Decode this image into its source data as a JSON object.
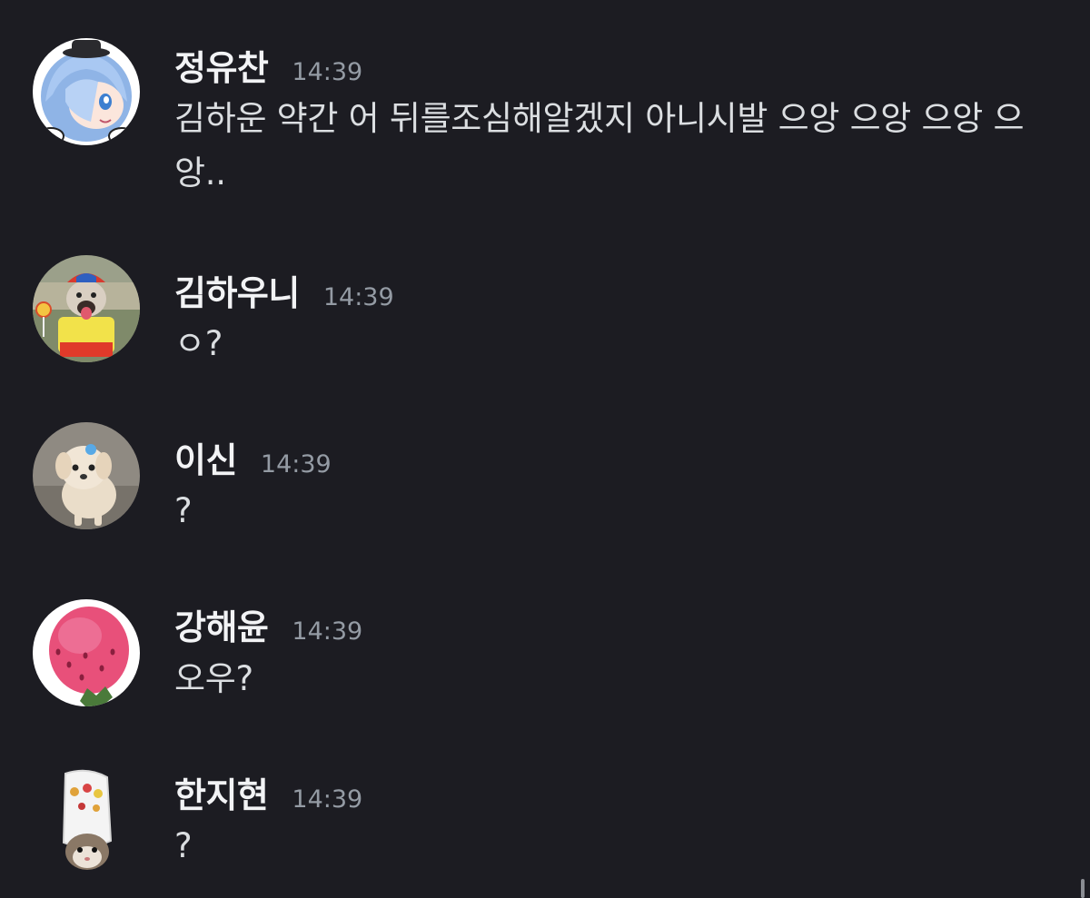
{
  "messages": [
    {
      "author": "정유찬",
      "time": "14:39",
      "text": "김하운 약간 어 뒤를조심해알겠지 아니시발 으앙 으앙 으앙 으앙..",
      "avatar": "anime-girl-avatar"
    },
    {
      "author": "김하우니",
      "time": "14:39",
      "text": "ㅇ?",
      "avatar": "dog-in-costume-avatar"
    },
    {
      "author": "이신",
      "time": "14:39",
      "text": "?",
      "avatar": "puppy-avatar"
    },
    {
      "author": "강해윤",
      "time": "14:39",
      "text": "오우?",
      "avatar": "strawberry-avatar"
    },
    {
      "author": "한지현",
      "time": "14:39",
      "text": "?",
      "avatar": "cat-in-croc-avatar"
    }
  ],
  "theme": {
    "background": "#1c1c22",
    "author_color": "#f2f3f5",
    "timestamp_color": "#949ba4",
    "text_color": "#dbdee1"
  }
}
